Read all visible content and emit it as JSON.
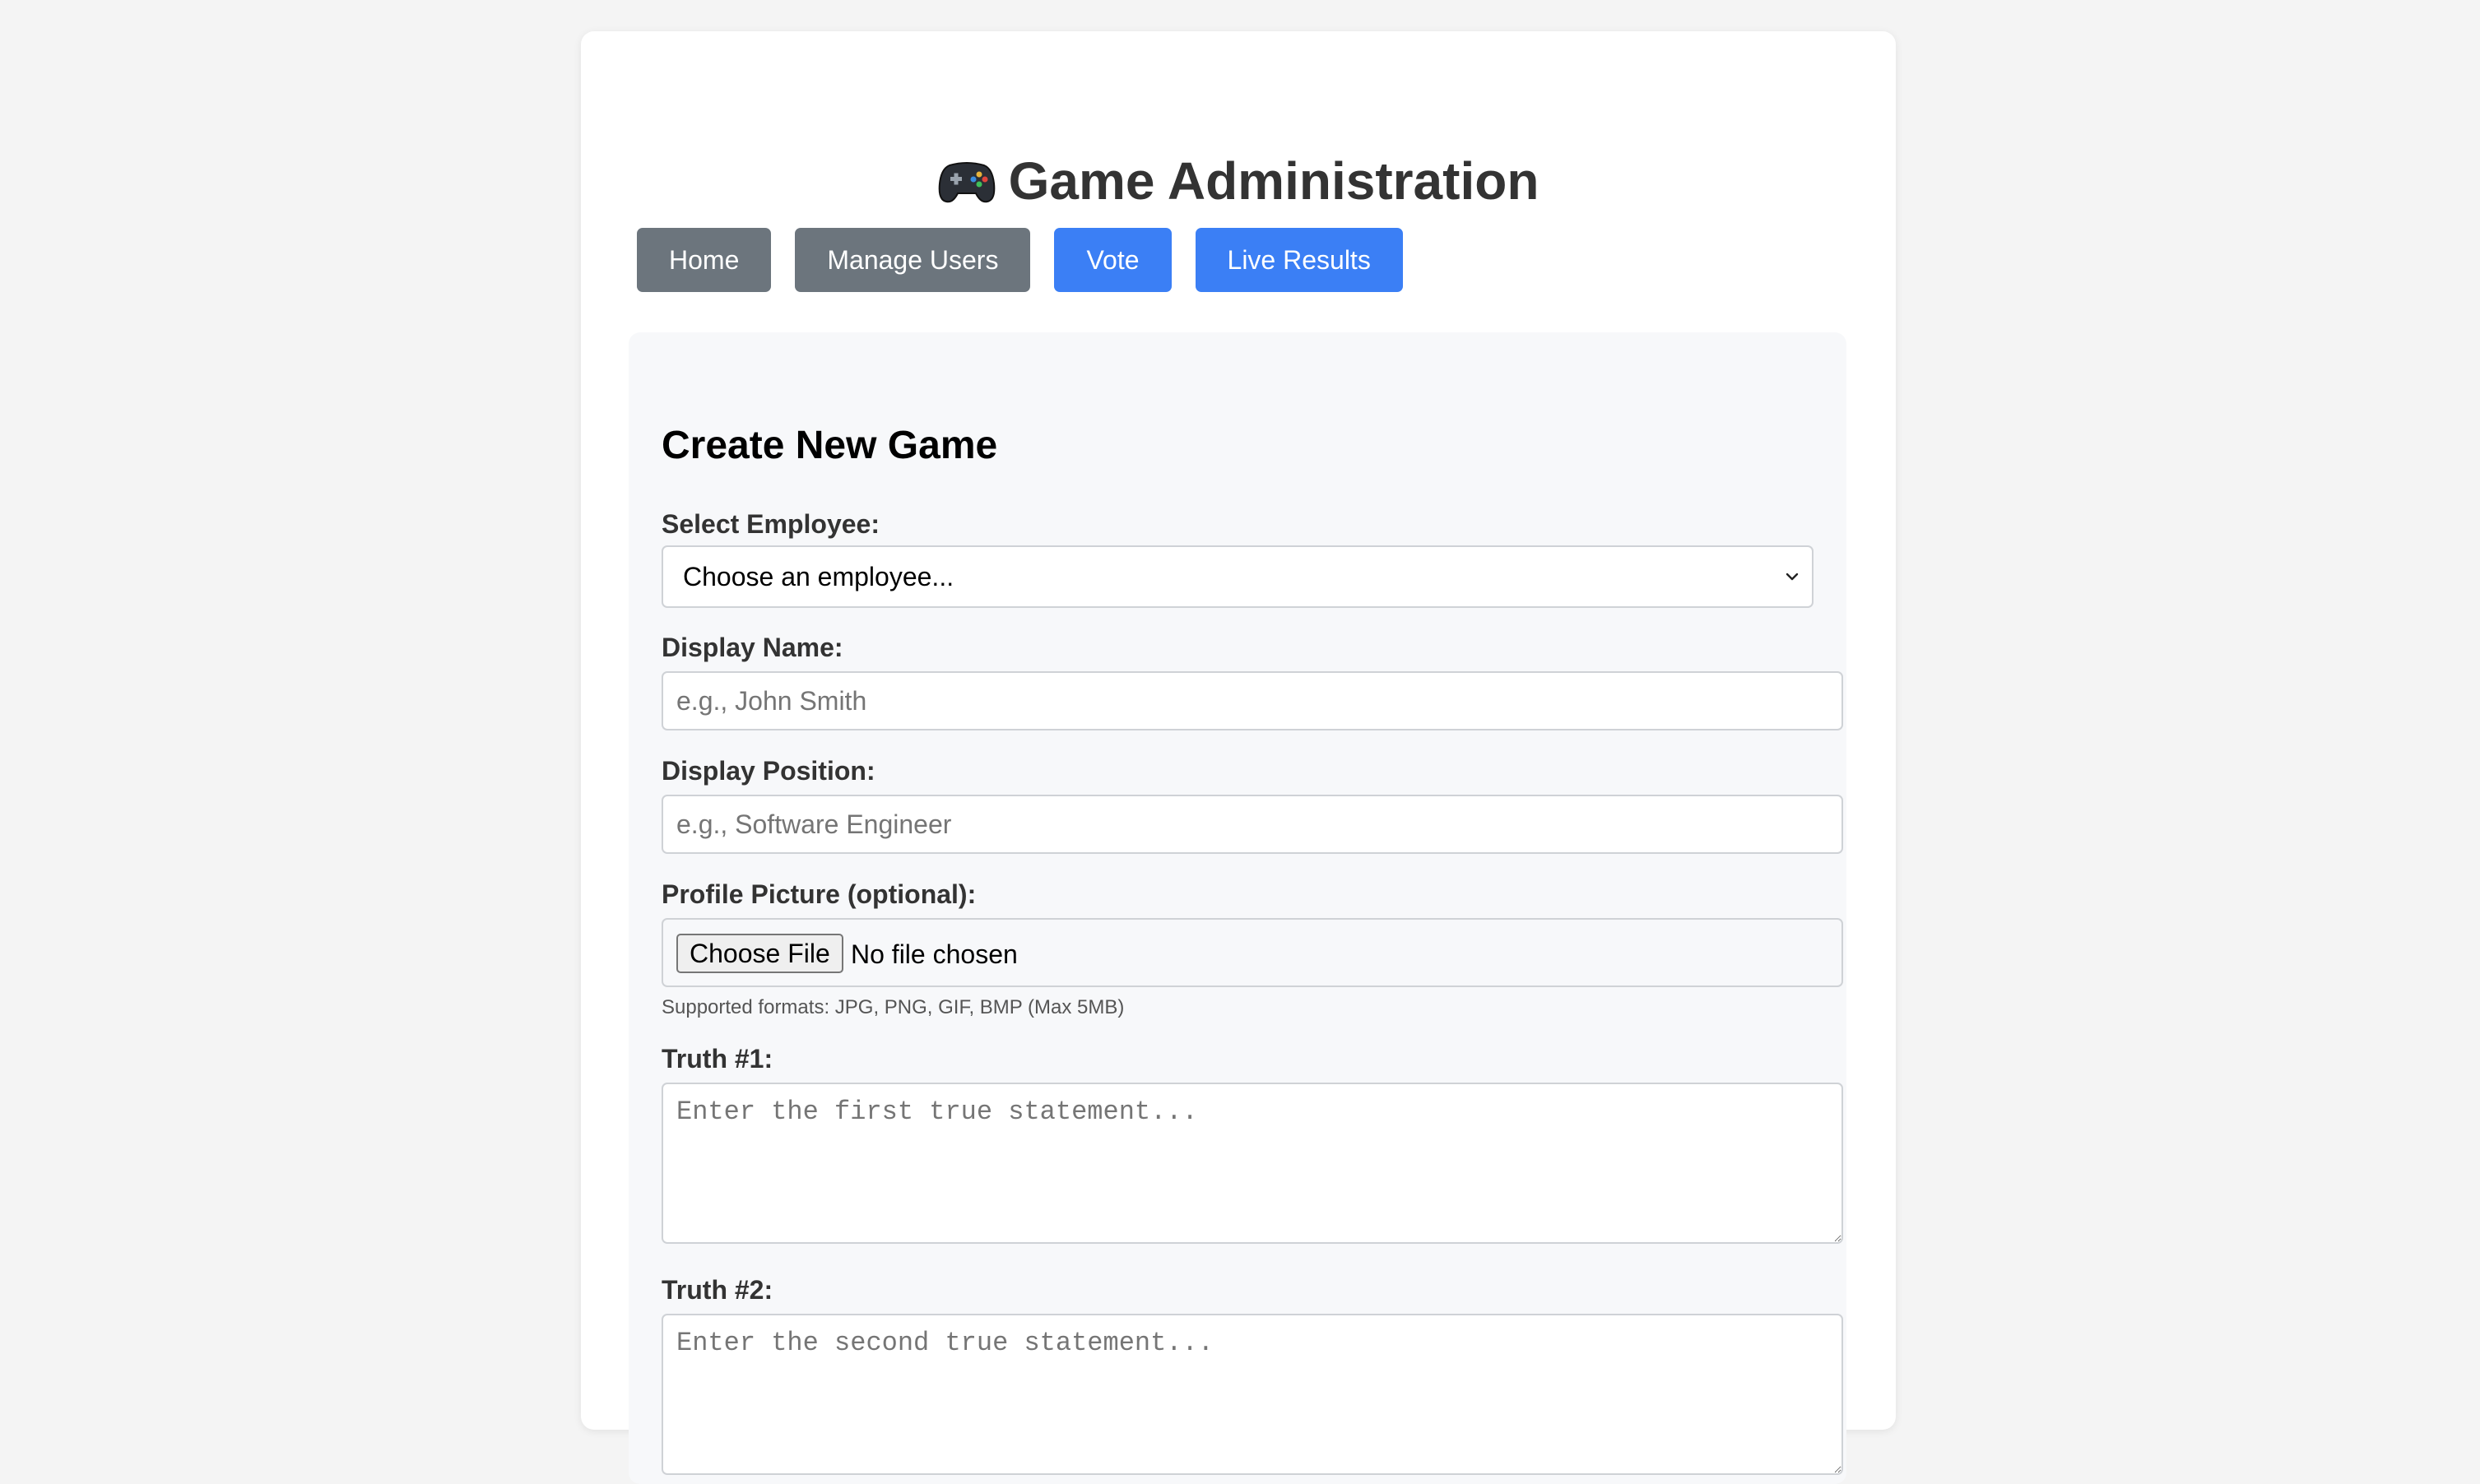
{
  "header": {
    "title": "Game Administration",
    "icon": "gamepad-icon"
  },
  "nav": {
    "home": "Home",
    "manage_users": "Manage Users",
    "vote": "Vote",
    "live_results": "Live Results"
  },
  "form": {
    "heading": "Create New Game",
    "employee_label": "Select Employee:",
    "employee_value": "Choose an employee...",
    "display_name_label": "Display Name:",
    "display_name_placeholder": "e.g., John Smith",
    "display_position_label": "Display Position:",
    "display_position_placeholder": "e.g., Software Engineer",
    "picture_label": "Profile Picture (optional):",
    "choose_file": "Choose File",
    "file_status": "No file chosen",
    "picture_hint": "Supported formats: JPG, PNG, GIF, BMP (Max 5MB)",
    "truth1_label": "Truth #1:",
    "truth1_placeholder": "Enter the first true statement...",
    "truth2_label": "Truth #2:",
    "truth2_placeholder": "Enter the second true statement..."
  },
  "colors": {
    "primary": "#3b7ff5",
    "secondary": "#6c757d",
    "background": "#f4f4f4"
  }
}
